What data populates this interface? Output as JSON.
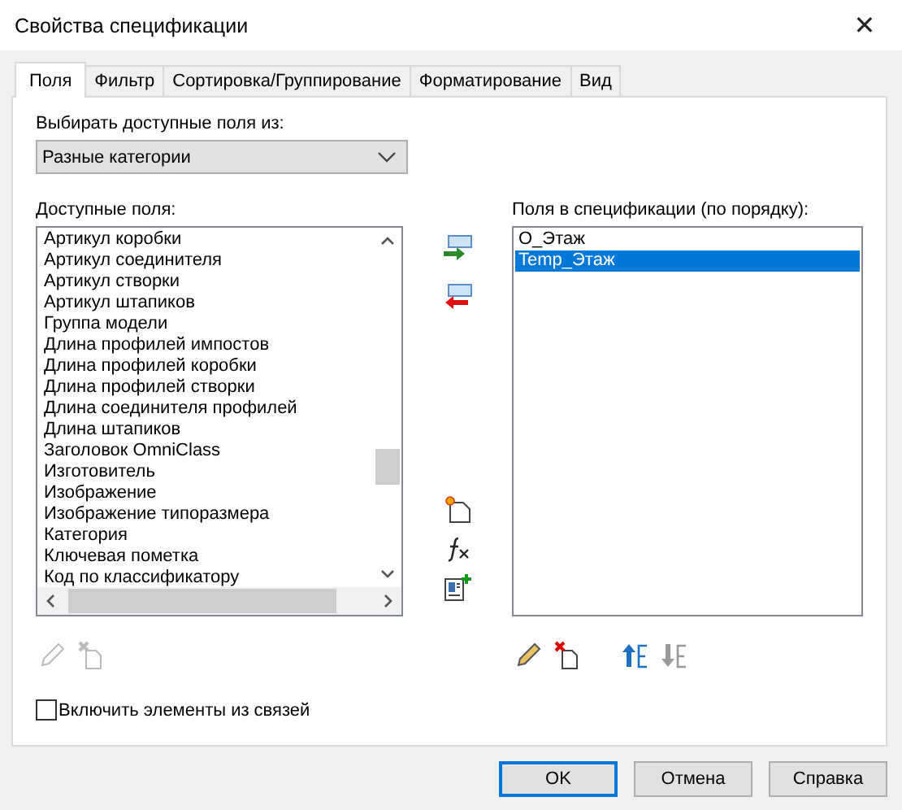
{
  "window": {
    "title": "Свойства спецификации",
    "close": "✕"
  },
  "tabs": [
    {
      "label": "Поля",
      "selected": true
    },
    {
      "label": "Фильтр",
      "selected": false
    },
    {
      "label": "Сортировка/Группирование",
      "selected": false
    },
    {
      "label": "Форматирование",
      "selected": false
    },
    {
      "label": "Вид",
      "selected": false
    }
  ],
  "source": {
    "label": "Выбирать доступные поля из:",
    "value": "Разные категории"
  },
  "available": {
    "label": "Доступные поля:",
    "items": [
      {
        "text": "Артикул коробки",
        "selected": false
      },
      {
        "text": "Артикул соединителя",
        "selected": false
      },
      {
        "text": "Артикул створки",
        "selected": false
      },
      {
        "text": "Артикул штапиков",
        "selected": false
      },
      {
        "text": "Группа модели",
        "selected": false
      },
      {
        "text": "Длина профилей импостов",
        "selected": false
      },
      {
        "text": "Длина профилей коробки",
        "selected": false
      },
      {
        "text": "Длина профилей створки",
        "selected": false
      },
      {
        "text": "Длина соединителя профилей",
        "selected": false
      },
      {
        "text": "Длина штапиков",
        "selected": false
      },
      {
        "text": "Заголовок OmniClass",
        "selected": false
      },
      {
        "text": "Изготовитель",
        "selected": false
      },
      {
        "text": "Изображение",
        "selected": false
      },
      {
        "text": "Изображение типоразмера",
        "selected": false
      },
      {
        "text": "Категория",
        "selected": false
      },
      {
        "text": "Ключевая пометка",
        "selected": false
      },
      {
        "text": "Код по классификатору",
        "selected": false
      }
    ],
    "tools": [
      {
        "kind": "edit",
        "disabled": true
      },
      {
        "kind": "delete",
        "disabled": true
      }
    ]
  },
  "middle_tools": [
    {
      "kind": "add"
    },
    {
      "kind": "remove"
    },
    {
      "kind": "new"
    },
    {
      "kind": "formula"
    },
    {
      "kind": "combine"
    }
  ],
  "scheduled": {
    "label": "Поля в спецификации (по порядку):",
    "items": [
      {
        "text": "О_Этаж",
        "selected": false
      },
      {
        "text": "Temp_Этаж",
        "selected": true
      }
    ],
    "tools": [
      {
        "kind": "edit",
        "disabled": false
      },
      {
        "kind": "delete",
        "disabled": false
      },
      {
        "kind": "up",
        "disabled": false
      },
      {
        "kind": "down",
        "disabled": true
      }
    ]
  },
  "include_links": {
    "label": "Включить элементы из связей",
    "checked": false
  },
  "buttons": [
    {
      "label": "OK",
      "default": true
    },
    {
      "label": "Отмена",
      "default": false
    },
    {
      "label": "Справка",
      "default": false
    }
  ]
}
